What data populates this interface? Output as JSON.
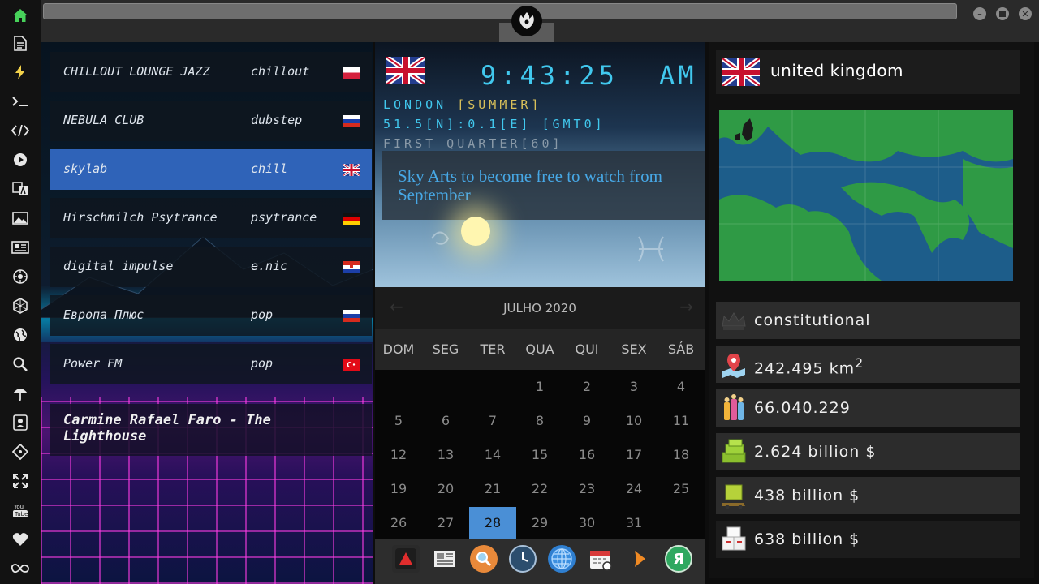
{
  "sidebar": {
    "items": [
      {
        "name": "home-icon",
        "active": true
      },
      {
        "name": "document-icon"
      },
      {
        "name": "lightning-icon"
      },
      {
        "name": "terminal-icon"
      },
      {
        "name": "code-icon"
      },
      {
        "name": "play-icon"
      },
      {
        "name": "translate-icon"
      },
      {
        "name": "image-icon"
      },
      {
        "name": "news-icon"
      },
      {
        "name": "rebel-icon"
      },
      {
        "name": "hexagon-icon"
      },
      {
        "name": "globe-icon"
      },
      {
        "name": "search-icon"
      },
      {
        "name": "umbrella-icon"
      },
      {
        "name": "contact-icon"
      },
      {
        "name": "git-icon"
      },
      {
        "name": "expand-icon"
      },
      {
        "name": "youtube-icon"
      },
      {
        "name": "heart-icon"
      },
      {
        "name": "infinity-icon"
      }
    ]
  },
  "colors": {
    "accent": "#2f63b8",
    "clock": "#41c8ee",
    "clock_location": "#41c8ee",
    "clock_dim": "#8a9aa8",
    "news": "#47a8e6",
    "today": "#4a8fd6"
  },
  "stations": [
    {
      "name": "CHILLOUT LOUNGE JAZZ",
      "genre": "chillout",
      "flag": "poland"
    },
    {
      "name": "NEBULA CLUB",
      "genre": "dubstep",
      "flag": "russia"
    },
    {
      "name": "skylab",
      "genre": "chill",
      "flag": "uk",
      "active": true
    },
    {
      "name": "Hirschmilch Psytrance",
      "genre": "psytrance",
      "flag": "germany"
    },
    {
      "name": "digital impulse",
      "genre": "e.nic",
      "flag": "croatia"
    },
    {
      "name": "Европа Плюс",
      "genre": "pop",
      "flag": "russia"
    },
    {
      "name": "Power FM",
      "genre": "pop",
      "flag": "turkey"
    }
  ],
  "now_playing": "Carmine Rafael Faro - The Lighthouse",
  "clock": {
    "time": "9:43:25",
    "ampm": "AM",
    "location": "LONDON",
    "season": "[SUMMER]",
    "coords": "51.5[N]:0.1[E] [GMT0]",
    "moon": "FIRST QUARTER[60]"
  },
  "news": {
    "headline": "Sky Arts to become free to watch from September"
  },
  "calendar": {
    "title": "JULHO 2020",
    "weekdays": [
      "DOM",
      "SEG",
      "TER",
      "QUA",
      "QUI",
      "SEX",
      "SÁB"
    ],
    "weeks": [
      [
        "",
        "",
        "",
        "1",
        "2",
        "3",
        "4"
      ],
      [
        "5",
        "6",
        "7",
        "8",
        "9",
        "10",
        "11"
      ],
      [
        "12",
        "13",
        "14",
        "15",
        "16",
        "17",
        "18"
      ],
      [
        "19",
        "20",
        "21",
        "22",
        "23",
        "24",
        "25"
      ],
      [
        "26",
        "27",
        "28",
        "29",
        "30",
        "31",
        ""
      ]
    ],
    "today": "28"
  },
  "dock": [
    "acrobat-icon",
    "newspaper-icon",
    "search-icon",
    "clock-icon",
    "globe-icon",
    "calendar-icon",
    "play-icon",
    "yandex-icon"
  ],
  "dock_yandex_letter": "Я",
  "country": {
    "name": "united kingdom",
    "government": "constitutional",
    "area_value": "242.495 km",
    "area_sup": "2",
    "population": "66.040.229",
    "gdp": "2.624 billion $",
    "exports": "438 billion $",
    "imports": "638 billion $"
  }
}
